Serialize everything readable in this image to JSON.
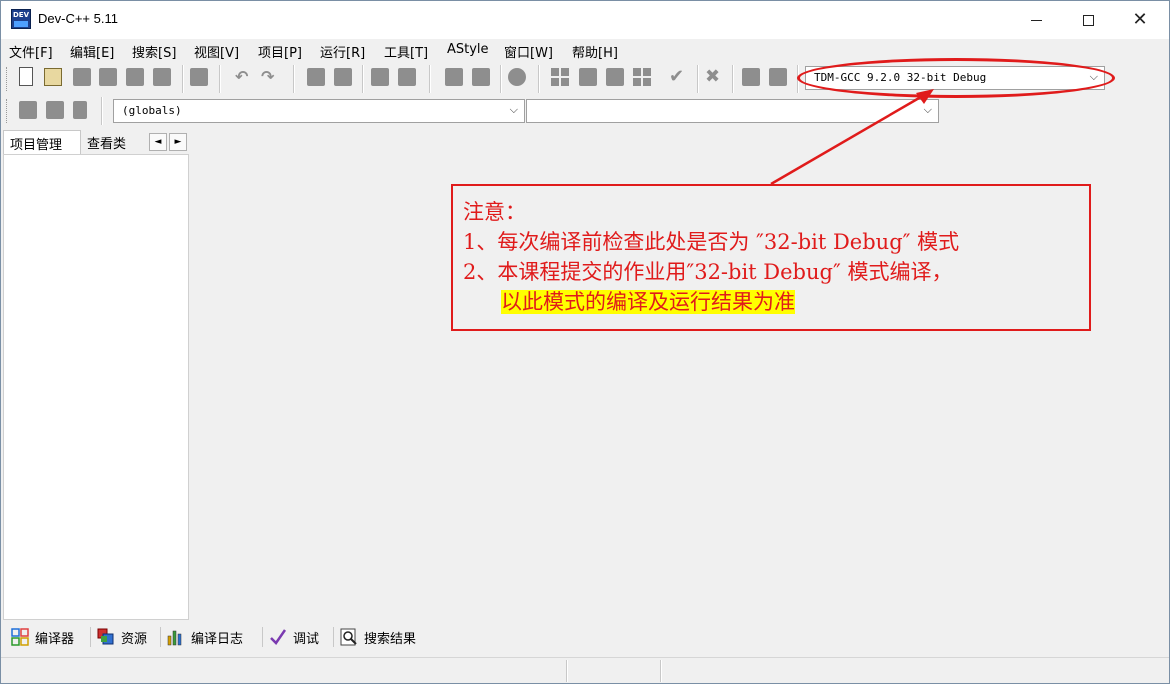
{
  "window": {
    "title": "Dev-C++ 5.11",
    "icon_text": "DEV",
    "controls": {
      "minimize": "minimize-icon",
      "maximize": "maximize-icon",
      "close": "close-icon"
    }
  },
  "menu": {
    "items": [
      "文件[F]",
      "编辑[E]",
      "搜索[S]",
      "视图[V]",
      "项目[P]",
      "运行[R]",
      "工具[T]",
      "AStyle",
      "窗口[W]",
      "帮助[H]"
    ]
  },
  "toolbar": {
    "compiler_select": "TDM-GCC 9.2.0 32-bit Debug",
    "scope_select": "(globals)",
    "function_select": ""
  },
  "left_tabs": {
    "items": [
      "项目管理",
      "查看类"
    ],
    "arrows": [
      "◄",
      "►"
    ]
  },
  "bottom_tabs": {
    "items": [
      "编译器",
      "资源",
      "编译日志",
      "调试",
      "搜索结果"
    ]
  },
  "annotation": {
    "lines": [
      "注意：",
      "1、每次编译前检查此处是否为 ″32-bit Debug″ 模式",
      "2、本课程提交的作业用″32-bit Debug″ 模式编译，",
      "以此模式的编译及运行结果为准"
    ],
    "color": "#e01b1b",
    "highlight_color": "#ffff00"
  }
}
